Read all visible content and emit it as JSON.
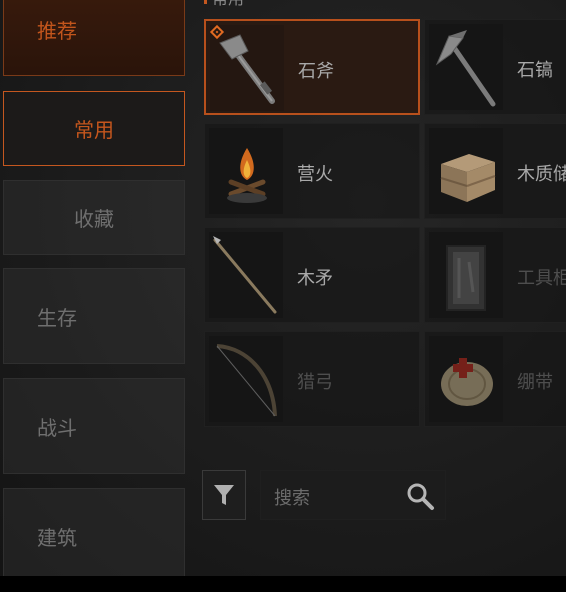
{
  "section_title": "常用",
  "categories": [
    {
      "label": "推荐",
      "state": "active"
    },
    {
      "label": "常用",
      "state": "selected"
    },
    {
      "label": "收藏",
      "state": "normal"
    },
    {
      "label": "生存",
      "state": "normal"
    },
    {
      "label": "战斗",
      "state": "normal"
    },
    {
      "label": "建筑",
      "state": "normal"
    }
  ],
  "items": [
    {
      "name": "石斧",
      "icon": "stone-axe-icon",
      "state": "selected"
    },
    {
      "name": "石镐",
      "icon": "stone-pickaxe-icon",
      "state": "normal"
    },
    {
      "name": "营火",
      "icon": "campfire-icon",
      "state": "normal"
    },
    {
      "name": "木质储",
      "icon": "wooden-crate-icon",
      "state": "normal"
    },
    {
      "name": "木矛",
      "icon": "wooden-spear-icon",
      "state": "normal"
    },
    {
      "name": "工具柜",
      "icon": "tool-cabinet-icon",
      "state": "dim"
    },
    {
      "name": "猎弓",
      "icon": "hunting-bow-icon",
      "state": "dim"
    },
    {
      "name": "绷带",
      "icon": "bandage-icon",
      "state": "dim"
    }
  ],
  "search": {
    "placeholder": "搜索"
  },
  "colors": {
    "accent": "#c4571f",
    "text_dim": "#6f6f6f"
  }
}
